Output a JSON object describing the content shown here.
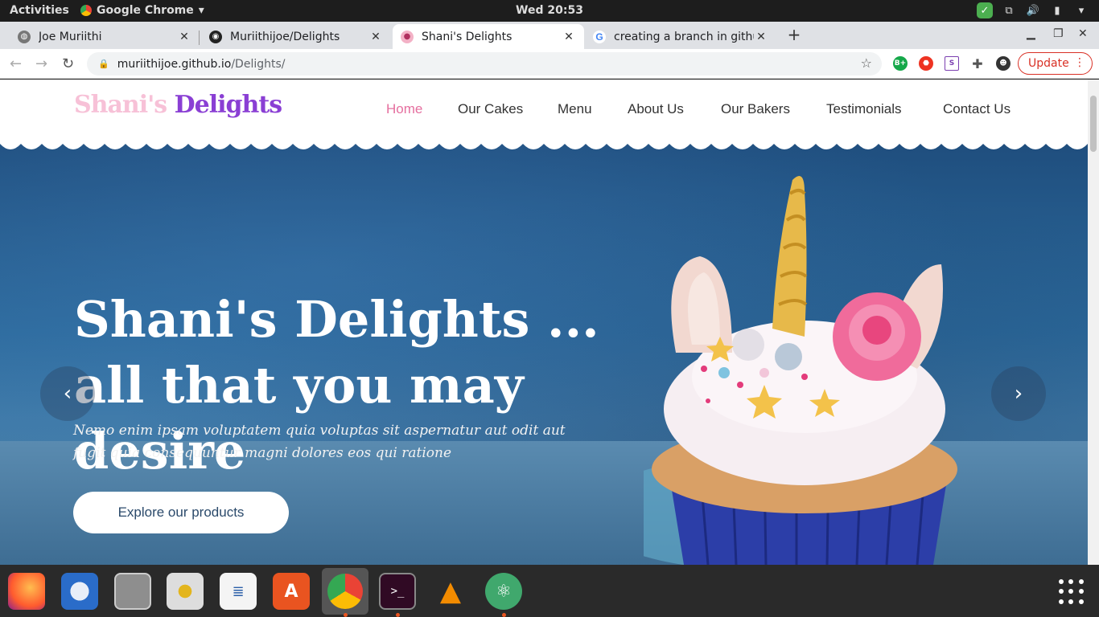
{
  "system_bar": {
    "activities": "Activities",
    "app_name": "Google Chrome",
    "clock": "Wed 20:53"
  },
  "tabs": [
    {
      "title": "Joe Muriithi",
      "favicon": "globe-icon"
    },
    {
      "title": "Muriithijoe/Delights",
      "favicon": "github-icon"
    },
    {
      "title": "Shani's Delights",
      "favicon": "cupcake-icon",
      "active": true
    },
    {
      "title": "creating a branch in githu",
      "favicon": "google-icon"
    }
  ],
  "address_bar": {
    "host": "muriithijoe.github.io",
    "path": "/Delights/"
  },
  "update_button": "Update",
  "site": {
    "logo_part1": "Shani's",
    "logo_part2": "Delights",
    "nav": [
      {
        "label": "Home",
        "active": true
      },
      {
        "label": "Our Cakes"
      },
      {
        "label": "Menu"
      },
      {
        "label": "About Us"
      },
      {
        "label": "Our Bakers"
      },
      {
        "label": "Testimonials"
      },
      {
        "label": "Contact Us"
      }
    ],
    "hero": {
      "title_line1": "Shani's Delights ...",
      "title_line2": "all that you may desire",
      "subtitle": "Nemo enim ipsam voluptatem quia voluptas sit aspernatur aut odit aut fugit quia consequuntur magni dolores eos qui ratione",
      "cta": "Explore our products"
    }
  },
  "colors": {
    "nav_active": "#e56f9f",
    "logo_pink": "#f7c1d7",
    "logo_purple": "#8a3fd4",
    "update_red": "#d93025"
  }
}
